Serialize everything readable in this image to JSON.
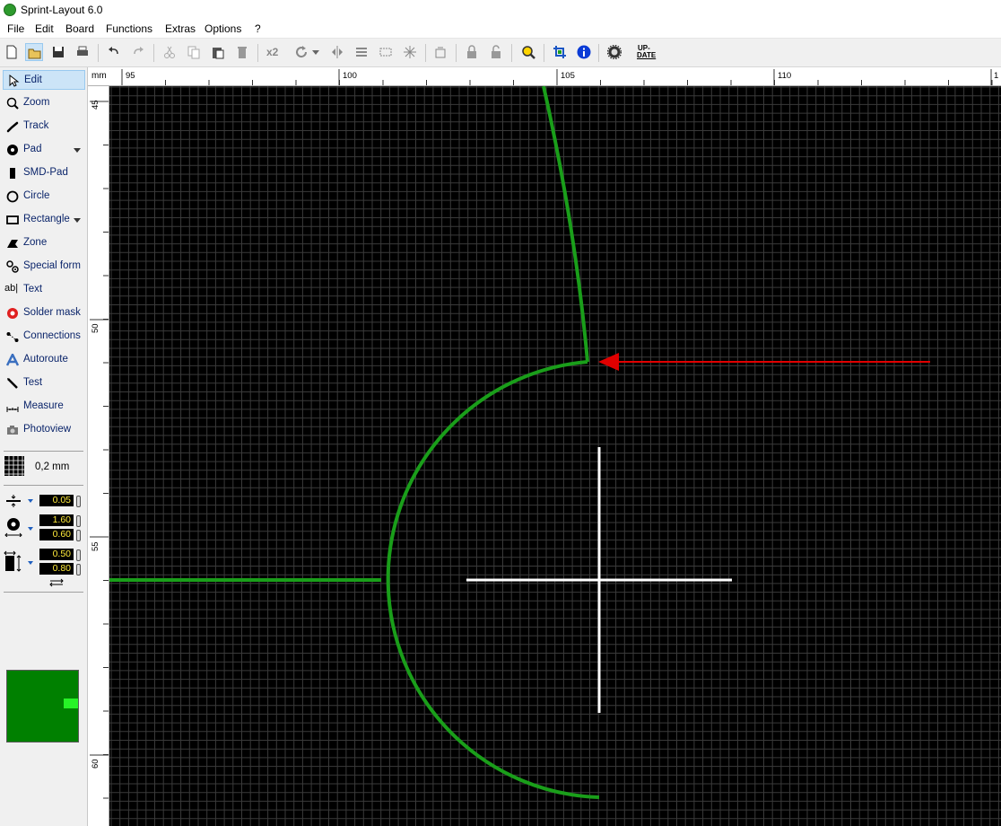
{
  "window": {
    "title": "Sprint-Layout 6.0"
  },
  "menu": [
    "File",
    "Edit",
    "Board",
    "Functions",
    "Extras",
    "Options",
    "?"
  ],
  "toolbar": {
    "buttons": [
      "new-file-icon",
      "open-folder-icon",
      "save-icon",
      "print-icon",
      "undo-icon",
      "redo-icon",
      "cut-icon",
      "copy-icon",
      "paste-icon",
      "delete-icon",
      "duplicate-x2-icon",
      "rotate-icon",
      "mirror-icon",
      "align-icon",
      "group-icon",
      "ungroup-icon",
      "properties-icon",
      "lock-icon",
      "unlock-icon",
      "zoom-icon",
      "crop-board-icon",
      "info-icon",
      "gear-icon",
      "update-icon"
    ],
    "duplicate_label": "x2",
    "update_label_top": "UP-",
    "update_label_bottom": "DATE"
  },
  "tools": [
    {
      "label": "Edit",
      "icon": "cursor-icon",
      "active": true
    },
    {
      "label": "Zoom",
      "icon": "magnifier-icon"
    },
    {
      "label": "Track",
      "icon": "track-icon"
    },
    {
      "label": "Pad",
      "icon": "pad-icon",
      "dropdown": true
    },
    {
      "label": "SMD-Pad",
      "icon": "smd-pad-icon"
    },
    {
      "label": "Circle",
      "icon": "circle-icon"
    },
    {
      "label": "Rectangle",
      "icon": "rectangle-icon",
      "dropdown": true
    },
    {
      "label": "Zone",
      "icon": "zone-icon"
    },
    {
      "label": "Special form",
      "icon": "special-form-icon"
    },
    {
      "label": "Text",
      "icon": "text-icon"
    },
    {
      "label": "Solder mask",
      "icon": "solder-mask-icon"
    },
    {
      "label": "Connections",
      "icon": "connections-icon"
    },
    {
      "label": "Autoroute",
      "icon": "autoroute-icon"
    },
    {
      "label": "Test",
      "icon": "test-icon"
    },
    {
      "label": "Measure",
      "icon": "measure-icon"
    },
    {
      "label": "Photoview",
      "icon": "camera-icon"
    }
  ],
  "grid": {
    "value": "0,2 mm"
  },
  "fields": {
    "track_width": "0.05",
    "pad_outer": "1.60",
    "pad_inner": "0.60",
    "smd_width": "0.50",
    "smd_height": "0.80"
  },
  "ruler": {
    "unit": "mm",
    "x_labels": [
      "95",
      "100",
      "105",
      "110",
      "1"
    ],
    "y_labels": [
      "45",
      "50",
      "55",
      "60"
    ]
  },
  "colors": {
    "canvas_background": "#000000",
    "grid_line": "#3a3a3a",
    "track_color": "#1a9e1a",
    "arrow_color": "#e00000",
    "crosshair_color": "#ffffff",
    "layer_preview": "#008000"
  }
}
